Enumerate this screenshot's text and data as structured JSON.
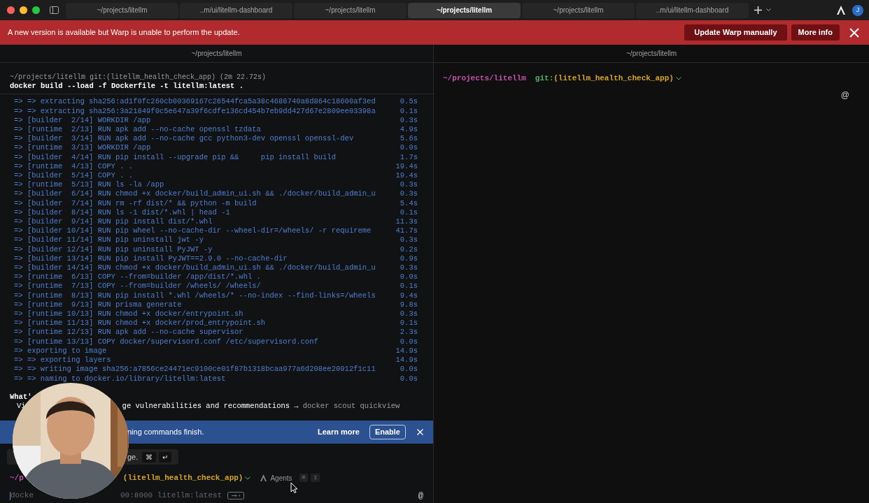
{
  "tabs": [
    {
      "label": "~/projects/litellm",
      "selected": false
    },
    {
      "label": "..m/ui/litellm-dashboard",
      "selected": false
    },
    {
      "label": "~/projects/litellm",
      "selected": false
    },
    {
      "label": "~/projects/litellm",
      "selected": true
    },
    {
      "label": "~/projects/litellm",
      "selected": false
    },
    {
      "label": "..m/ui/litellm-dashboard",
      "selected": false
    }
  ],
  "avatar": "J",
  "banner": {
    "message": "A new version is available but Warp is unable to perform the update.",
    "buttons": [
      "Update Warp manually",
      "More info"
    ]
  },
  "left_pane": {
    "title": "~/projects/litellm",
    "block": {
      "context": "~/projects/litellm git:(litellm_health_check_app) (2m 22.72s)",
      "command": "docker build --load -f Dockerfile -t litellm:latest .",
      "output": [
        {
          "text": "=> => extracting sha256:ad1f0fc260cb00369167c26544fca5a38c4688740a8d864c18600af3ed",
          "time": "0.5s"
        },
        {
          "text": "=> => extracting sha256:3a21849f0c5e647a39f6cdfe136cd454b7eb9dd427d67e2809ee03398a",
          "time": "0.1s"
        },
        {
          "text": "=> [builder  2/14] WORKDIR /app",
          "time": "0.3s"
        },
        {
          "text": "=> [runtime  2/13] RUN apk add --no-cache openssl tzdata",
          "time": "4.9s"
        },
        {
          "text": "=> [builder  3/14] RUN apk add --no-cache gcc python3-dev openssl openssl-dev",
          "time": "5.6s"
        },
        {
          "text": "=> [runtime  3/13] WORKDIR /app",
          "time": "0.0s"
        },
        {
          "text": "=> [builder  4/14] RUN pip install --upgrade pip &&     pip install build",
          "time": "1.7s"
        },
        {
          "text": "=> [runtime  4/13] COPY . .",
          "time": "19.4s"
        },
        {
          "text": "=> [builder  5/14] COPY . .",
          "time": "19.4s"
        },
        {
          "text": "=> [runtime  5/13] RUN ls -la /app",
          "time": "0.3s"
        },
        {
          "text": "=> [builder  6/14] RUN chmod +x docker/build_admin_ui.sh && ./docker/build_admin_u",
          "time": "0.3s"
        },
        {
          "text": "=> [builder  7/14] RUN rm -rf dist/* && python -m build",
          "time": "5.4s"
        },
        {
          "text": "=> [builder  8/14] RUN ls -1 dist/*.whl | head -1",
          "time": "0.1s"
        },
        {
          "text": "=> [builder  9/14] RUN pip install dist/*.whl",
          "time": "11.3s"
        },
        {
          "text": "=> [builder 10/14] RUN pip wheel --no-cache-dir --wheel-dir=/wheels/ -r requireme",
          "time": "41.7s"
        },
        {
          "text": "=> [builder 11/14] RUN pip uninstall jwt -y",
          "time": "0.3s"
        },
        {
          "text": "=> [builder 12/14] RUN pip uninstall PyJWT -y",
          "time": "0.2s"
        },
        {
          "text": "=> [builder 13/14] RUN pip install PyJWT==2.9.0 --no-cache-dir",
          "time": "0.9s"
        },
        {
          "text": "=> [builder 14/14] RUN chmod +x docker/build_admin_ui.sh && ./docker/build_admin_u",
          "time": "0.3s"
        },
        {
          "text": "=> [runtime  6/13] COPY --from=builder /app/dist/*.whl .",
          "time": "0.0s"
        },
        {
          "text": "=> [runtime  7/13] COPY --from=builder /wheels/ /wheels/",
          "time": "0.1s"
        },
        {
          "text": "=> [runtime  8/13] RUN pip install *.whl /wheels/* --no-index --find-links=/wheels",
          "time": "9.4s"
        },
        {
          "text": "=> [runtime  9/13] RUN prisma generate",
          "time": "9.8s"
        },
        {
          "text": "=> [runtime 10/13] RUN chmod +x docker/entrypoint.sh",
          "time": "0.3s"
        },
        {
          "text": "=> [runtime 11/13] RUN chmod +x docker/prod_entrypoint.sh",
          "time": "0.1s"
        },
        {
          "text": "=> [runtime 12/13] RUN apk add --no-cache supervisor",
          "time": "2.3s"
        },
        {
          "text": "=> [runtime 13/13] COPY docker/supervisord.conf /etc/supervisord.conf",
          "time": "0.0s"
        },
        {
          "text": "=> exporting to image",
          "time": "14.9s"
        },
        {
          "text": "=> => exporting layers",
          "time": "14.9s"
        },
        {
          "text": "=> => writing image sha256:a7856ce24471ec9100ce01f87b1318bcaa977a6d208ee20912f1c11",
          "time": "0.0s"
        },
        {
          "text": "=> => naming to docker.io/library/litellm:latest",
          "time": "0.0s"
        }
      ],
      "after": {
        "heading": "What'",
        "line_start": "Vi",
        "line_rest": "ge vulnerabilities and recommendations →",
        "hint_command": "docker scout quickview"
      }
    },
    "notification": {
      "message": "ning commands finish.",
      "buttons": [
        "Learn more",
        "Enable"
      ]
    },
    "hint": {
      "text": "ge.",
      "keys": [
        "⌘",
        "↵"
      ]
    },
    "prompt": {
      "dir": "~/p",
      "branch": "(litellm_health_check_app)",
      "agents": "Agents",
      "keys": [
        "⌘",
        "I"
      ]
    },
    "input": {
      "parts": [
        "docke",
        "00:8000 litellm:latest"
      ],
      "mention_symbol": "@"
    }
  },
  "right_pane": {
    "title": "~/projects/litellm",
    "prompt": {
      "dir": "~/projects/litellm",
      "git": "git:",
      "branch": "(litellm_health_check_app)"
    },
    "mention_symbol": "@"
  }
}
